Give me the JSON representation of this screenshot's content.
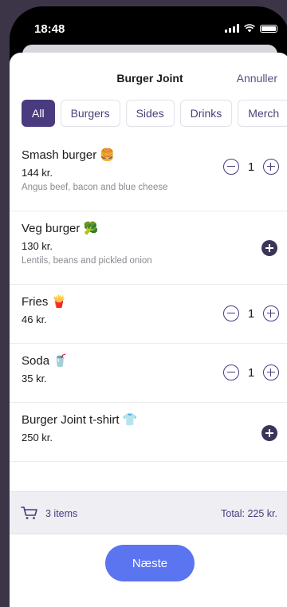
{
  "status": {
    "time": "18:48"
  },
  "header": {
    "title": "Burger Joint",
    "cancel": "Annuller"
  },
  "tabs": [
    "All",
    "Burgers",
    "Sides",
    "Drinks",
    "Merch"
  ],
  "items": [
    {
      "name": "Smash burger 🍔",
      "price": "144 kr.",
      "desc": "Angus beef, bacon and blue cheese",
      "qty": "1"
    },
    {
      "name": "Veg burger 🥦",
      "price": "130 kr.",
      "desc": "Lentils, beans and pickled onion",
      "qty": ""
    },
    {
      "name": "Fries 🍟",
      "price": "46 kr.",
      "desc": "",
      "qty": "1"
    },
    {
      "name": "Soda 🥤",
      "price": "35 kr.",
      "desc": "",
      "qty": "1"
    },
    {
      "name": "Burger Joint t-shirt 👕",
      "price": "250 kr.",
      "desc": "",
      "qty": ""
    }
  ],
  "summary": {
    "count": "3 items",
    "total": "Total: 225 kr."
  },
  "footer": {
    "next": "Næste"
  },
  "colors": {
    "accent": "#4a3a80",
    "button": "#5b74f0",
    "background": "#3b3547"
  },
  "icons": {
    "minus": "minus-circle-icon",
    "plus": "plus-circle-icon",
    "cart": "cart-icon"
  }
}
